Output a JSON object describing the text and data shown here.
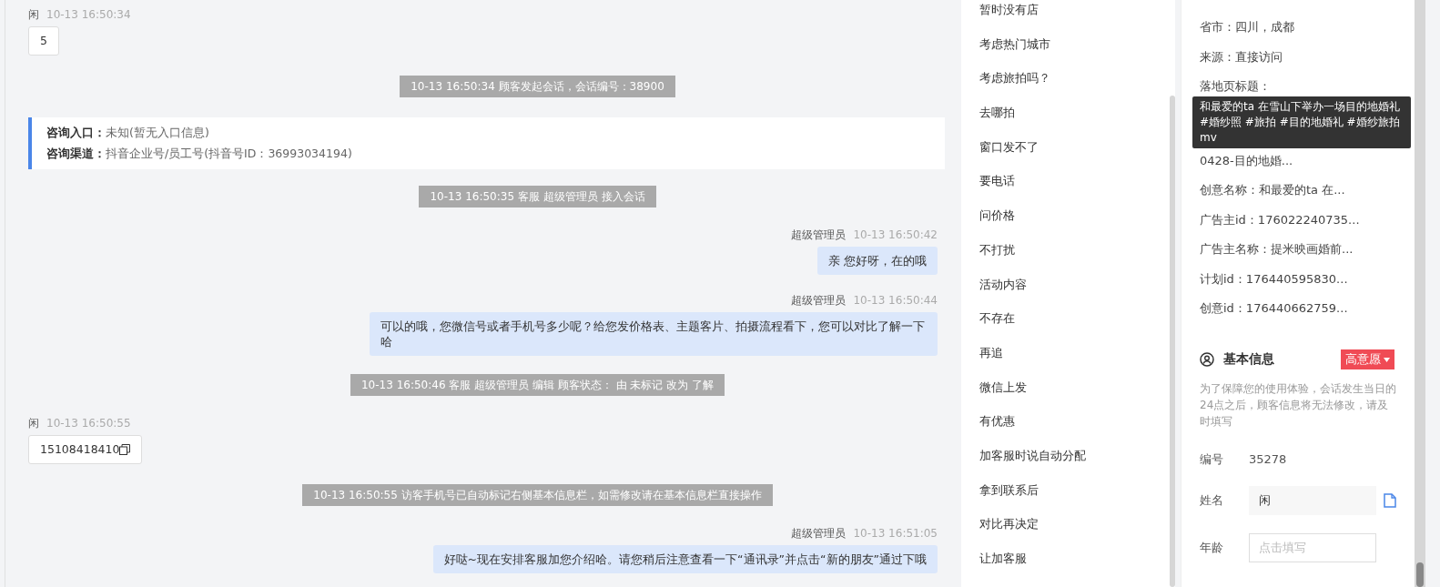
{
  "chat": {
    "messages": [
      {
        "kind": "customer",
        "sender": "闲",
        "time": "10-13 16:50:34",
        "text": "5"
      },
      {
        "kind": "system",
        "text": "10-13 16:50:34 顾客发起会话，会话编号：38900"
      },
      {
        "kind": "entry",
        "rows": [
          {
            "label": "咨询入口：",
            "value": "未知(暂无入口信息)"
          },
          {
            "label": "咨询渠道：",
            "value": "抖音企业号/员工号(抖音号ID：36993034194)"
          }
        ]
      },
      {
        "kind": "system",
        "text": "10-13 16:50:35 客服 超级管理员 接入会话"
      },
      {
        "kind": "agent",
        "sender": "超级管理员",
        "time": "10-13 16:50:42",
        "text": "亲 您好呀，在的哦"
      },
      {
        "kind": "agent",
        "sender": "超级管理员",
        "time": "10-13 16:50:44",
        "text": "可以的哦，您微信号或者手机号多少呢？给您发价格表、主题客片、拍摄流程看下，您可以对比了解一下哈"
      },
      {
        "kind": "system",
        "text": "10-13 16:50:46 客服 超级管理员 编辑 顾客状态： 由 未标记 改为 了解"
      },
      {
        "kind": "phone",
        "sender": "闲",
        "time": "10-13 16:50:55",
        "text": "15108418410"
      },
      {
        "kind": "system",
        "text": "10-13 16:50:55 访客手机号已自动标记右侧基本信息栏，如需修改请在基本信息栏直接操作"
      },
      {
        "kind": "agent",
        "sender": "超级管理员",
        "time": "10-13 16:51:05",
        "text": "好哒~现在安排客服加您介绍哈。请您稍后注意查看一下“通讯录”并点击“新的朋友”通过下哦"
      }
    ]
  },
  "quick_replies": [
    "暂时没有店",
    "考虑热门城市",
    "考虑旅拍吗？",
    "去哪拍",
    "窗口发不了",
    "要电话",
    "问价格",
    "不打扰",
    "活动内容",
    "不存在",
    "再追",
    "微信上发",
    "有优惠",
    "加客服时说自动分配",
    "拿到联系后",
    "对比再决定",
    "让加客服"
  ],
  "source_info": {
    "rows": [
      {
        "text": "省市：四川，成都"
      },
      {
        "text": "来源：直接访问"
      },
      {
        "text": "落地页标题："
      },
      {
        "text": ""
      },
      {
        "text": "0428-目的地婚..."
      },
      {
        "text": "创意名称：和最爱的ta 在..."
      },
      {
        "text": "广告主id：176022240735..."
      },
      {
        "text": "广告主名称：提米映画婚前..."
      },
      {
        "text": "计划id：176440595830..."
      },
      {
        "text": "创意id：176440662759..."
      }
    ],
    "tooltip": "和最爱的ta 在雪山下举办一场目的地婚礼#婚纱照 #旅拍 #目的地婚礼 #婚纱旅拍mv"
  },
  "basic_info": {
    "title": "基本信息",
    "intent_tag": "高意愿",
    "note": "为了保障您的使用体验，会话发生当日的24点之后，顾客信息将无法修改，请及时填写",
    "fields": [
      {
        "kind": "static",
        "label": "编号",
        "value": "35278"
      },
      {
        "kind": "input",
        "label": "姓名",
        "value": "闲",
        "copyable": true
      },
      {
        "kind": "input",
        "label": "年龄",
        "placeholder": "点击填写",
        "copyable": false
      }
    ]
  }
}
